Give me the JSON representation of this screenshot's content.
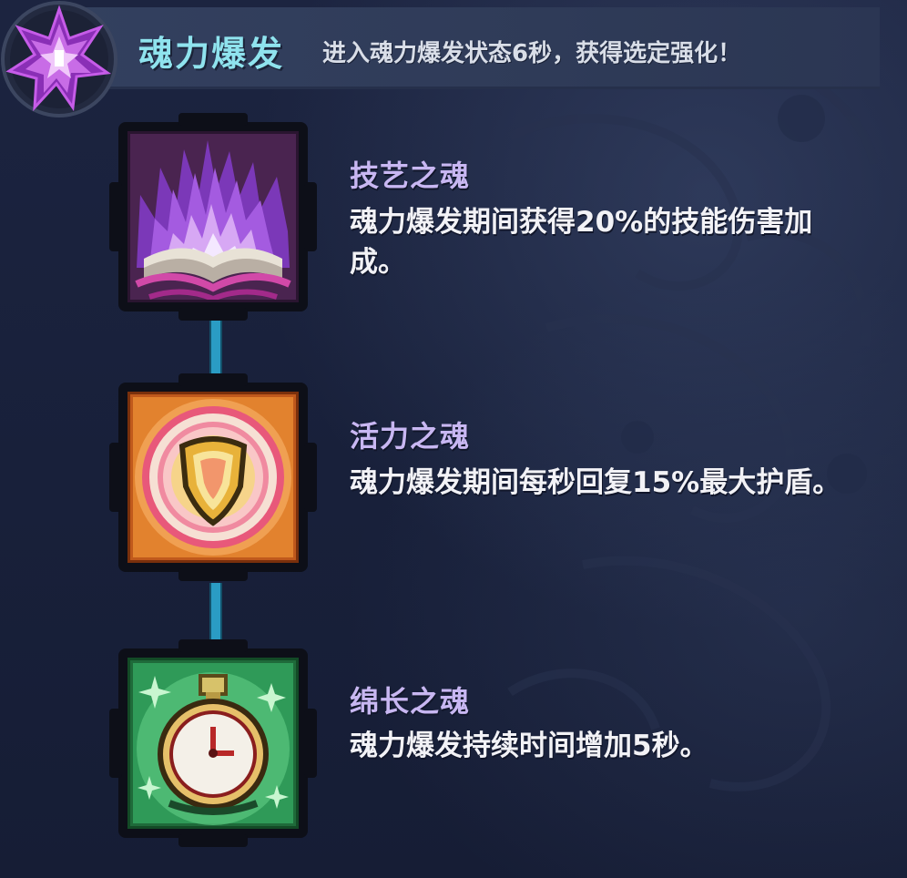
{
  "header": {
    "title": "魂力爆发",
    "description": "进入魂力爆发状态6秒，获得选定强化！",
    "emblem_icon": "purple-star-crystal-icon"
  },
  "perks": [
    {
      "name": "技艺之魂",
      "description": "魂力爆发期间获得20%的技能伤害加成。",
      "icon": "purple-flame-book-icon"
    },
    {
      "name": "活力之魂",
      "description": "魂力爆发期间每秒回复15%最大护盾。",
      "icon": "golden-shield-icon"
    },
    {
      "name": "绵长之魂",
      "description": "魂力爆发持续时间增加5秒。",
      "icon": "stopwatch-icon"
    }
  ],
  "colors": {
    "title": "#8fe3ee",
    "perk_name": "#c8b7f2",
    "connector": "#2a9cc4",
    "background": "#1a2139"
  }
}
